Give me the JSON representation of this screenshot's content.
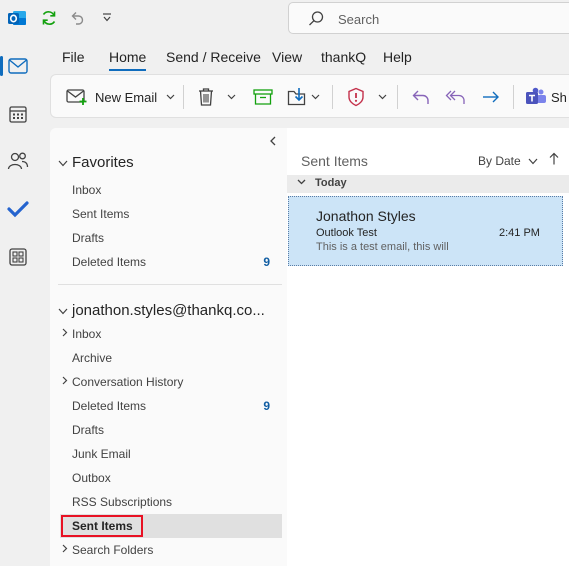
{
  "titlebar": {
    "app_icon": "outlook-logo-icon",
    "sync_icon": "sync-icon",
    "undo_icon": "undo-icon",
    "customize_icon": "quick-access-customize-icon",
    "search_placeholder": "Search"
  },
  "rail": [
    {
      "name": "mail-icon",
      "active": true
    },
    {
      "name": "calendar-icon",
      "active": false
    },
    {
      "name": "people-icon",
      "active": false
    },
    {
      "name": "todo-icon",
      "active": false
    },
    {
      "name": "apps-icon",
      "active": false
    }
  ],
  "menu": {
    "tabs": [
      {
        "label": "File"
      },
      {
        "label": "Home"
      },
      {
        "label": "Send / Receive"
      },
      {
        "label": "View"
      },
      {
        "label": "thankQ"
      },
      {
        "label": "Help"
      }
    ],
    "active": "Home"
  },
  "ribbon": {
    "new_email": "New Email",
    "teams_label": "Sh"
  },
  "favorites": {
    "header": "Favorites",
    "items": [
      {
        "label": "Inbox",
        "count": ""
      },
      {
        "label": "Sent Items",
        "count": ""
      },
      {
        "label": "Drafts",
        "count": ""
      },
      {
        "label": "Deleted Items",
        "count": "9"
      }
    ]
  },
  "account": {
    "header": "jonathon.styles@thankq.co...",
    "items": [
      {
        "label": "Inbox",
        "count": "",
        "expandable": true
      },
      {
        "label": "Archive",
        "count": "",
        "expandable": false
      },
      {
        "label": "Conversation History",
        "count": "",
        "expandable": true
      },
      {
        "label": "Deleted Items",
        "count": "9",
        "expandable": false
      },
      {
        "label": "Drafts",
        "count": "",
        "expandable": false
      },
      {
        "label": "Junk Email",
        "count": "",
        "expandable": false
      },
      {
        "label": "Outbox",
        "count": "",
        "expandable": false
      },
      {
        "label": "RSS Subscriptions",
        "count": "",
        "expandable": false
      },
      {
        "label": "Sent Items",
        "count": "",
        "expandable": false,
        "selected": true
      },
      {
        "label": "Search Folders",
        "count": "",
        "expandable": true
      }
    ]
  },
  "message_list": {
    "title": "Sent Items",
    "sort_label": "By Date",
    "group_label": "Today",
    "messages": [
      {
        "from": "Jonathon Styles",
        "subject": "Outlook Test",
        "time": "2:41 PM",
        "preview": "This is a test email, this will"
      }
    ]
  },
  "colors": {
    "accent": "#0f6cbd",
    "selected_message_bg": "#cce4f7",
    "highlight_outline": "#e81123",
    "count_color": "#115ea3"
  }
}
